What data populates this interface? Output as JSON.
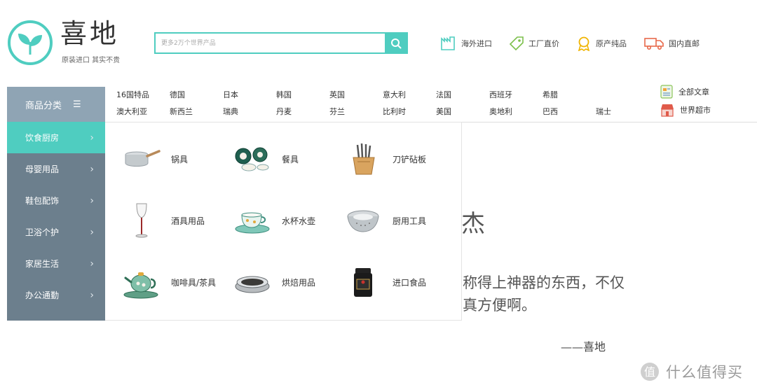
{
  "brand": {
    "name": "喜地",
    "slogan": "原装进口 其实不贵",
    "color": "#4fcdc0"
  },
  "search": {
    "placeholder": "更多2万个世界产品"
  },
  "features": [
    {
      "label": "海外进口",
      "icon": "factory-icon"
    },
    {
      "label": "工厂直价",
      "icon": "price-tag-icon"
    },
    {
      "label": "原产纯品",
      "icon": "award-icon"
    },
    {
      "label": "国内直邮",
      "icon": "truck-icon"
    }
  ],
  "category_bar": {
    "label": "商品分类",
    "menu_glyph": "☰"
  },
  "countries": {
    "row1": [
      "16国特品",
      "德国",
      "日本",
      "韩国",
      "英国",
      "意大利",
      "法国",
      "西班牙",
      "希腊"
    ],
    "row2": [
      "澳大利亚",
      "新西兰",
      "瑞典",
      "丹麦",
      "芬兰",
      "比利时",
      "美国",
      "奥地利",
      "巴西",
      "瑞士"
    ]
  },
  "side_links": [
    {
      "label": "全部文章",
      "icon": "article-icon"
    },
    {
      "label": "世界超市",
      "icon": "store-icon"
    }
  ],
  "side_menu": [
    {
      "label": "饮食厨房",
      "active": true
    },
    {
      "label": "母婴用品",
      "active": false
    },
    {
      "label": "鞋包配饰",
      "active": false
    },
    {
      "label": "卫浴个护",
      "active": false
    },
    {
      "label": "家居生活",
      "active": false
    },
    {
      "label": "办公通勤",
      "active": false
    }
  ],
  "subcategories": [
    {
      "label": "锅具",
      "icon": "saucepan-icon"
    },
    {
      "label": "餐具",
      "icon": "dinnerware-icon"
    },
    {
      "label": "刀铲砧板",
      "icon": "knife-block-icon"
    },
    {
      "label": "酒具用品",
      "icon": "wine-glass-icon"
    },
    {
      "label": "水杯水壶",
      "icon": "teacup-icon"
    },
    {
      "label": "厨用工具",
      "icon": "colander-icon"
    },
    {
      "label": "咖啡具/茶具",
      "icon": "teapot-icon"
    },
    {
      "label": "烘焙用品",
      "icon": "baking-pan-icon"
    },
    {
      "label": "进口食品",
      "icon": "honey-jar-icon"
    }
  ],
  "background_text": {
    "line1": "杰",
    "line2": "称得上神器的东西，不仅",
    "line3": "真方便啊。",
    "signature": "——喜地"
  },
  "watermark": {
    "text": "什么值得买",
    "icon": "smzdm-logo-icon"
  }
}
